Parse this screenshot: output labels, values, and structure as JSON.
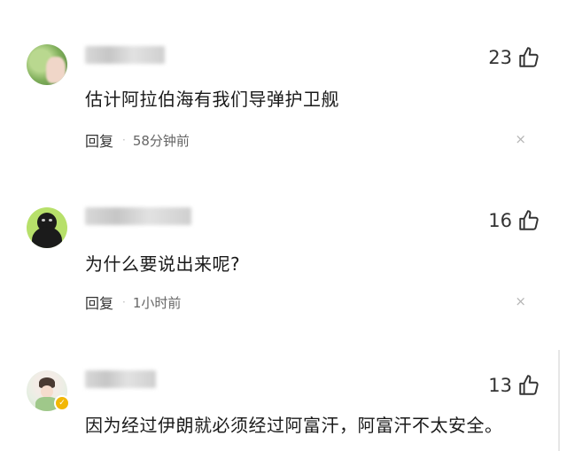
{
  "comments": [
    {
      "likes": "23",
      "text": "估计阿拉伯海有我们导弹护卫舰",
      "reply_label": "回复",
      "time": "58分钟前",
      "close_glyph": "×"
    },
    {
      "likes": "16",
      "text": "为什么要说出来呢?",
      "reply_label": "回复",
      "time": "1小时前",
      "close_glyph": "×"
    },
    {
      "likes": "13",
      "text": "因为经过伊朗就必须经过阿富汗，阿富汗不太安全。"
    }
  ],
  "separator": "·",
  "icons": {
    "like": "thumbs-up-icon",
    "close": "close-icon"
  }
}
